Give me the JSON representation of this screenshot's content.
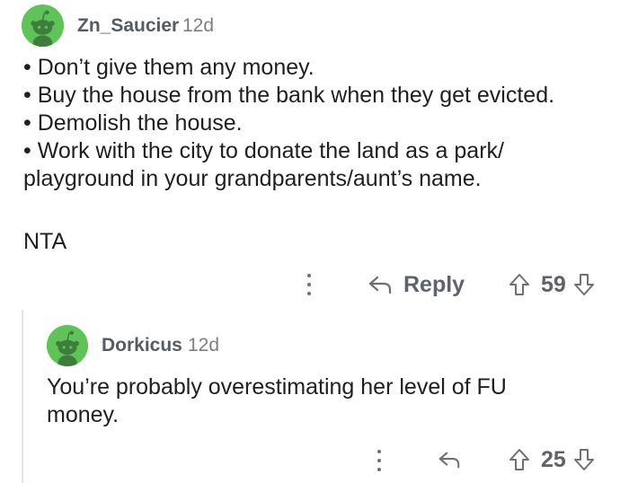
{
  "comments": [
    {
      "username": "Zn_Saucier",
      "age": "12d",
      "lines": [
        "• Don’t give them any money.",
        "• Buy the house from the bank when they get evicted.",
        "• Demolish the house.",
        "• Work with the city to donate the land as a park/",
        "playground in your grandparents/aunt’s name."
      ],
      "closing": "NTA",
      "reply_label": "Reply",
      "votes": "59"
    },
    {
      "username": "Dorkicus",
      "age": "12d",
      "lines": [
        "You’re probably overestimating her level of FU",
        "money."
      ],
      "votes": "25"
    }
  ],
  "colors": {
    "avatar_green": "#5fc35a",
    "meta_grey": "#6d7176"
  },
  "icons": {
    "avatar": "snoo-avatar-icon",
    "more": "kebab-menu-icon",
    "reply": "reply-arrow-icon",
    "upvote": "upvote-arrow-icon",
    "downvote": "downvote-arrow-icon"
  }
}
